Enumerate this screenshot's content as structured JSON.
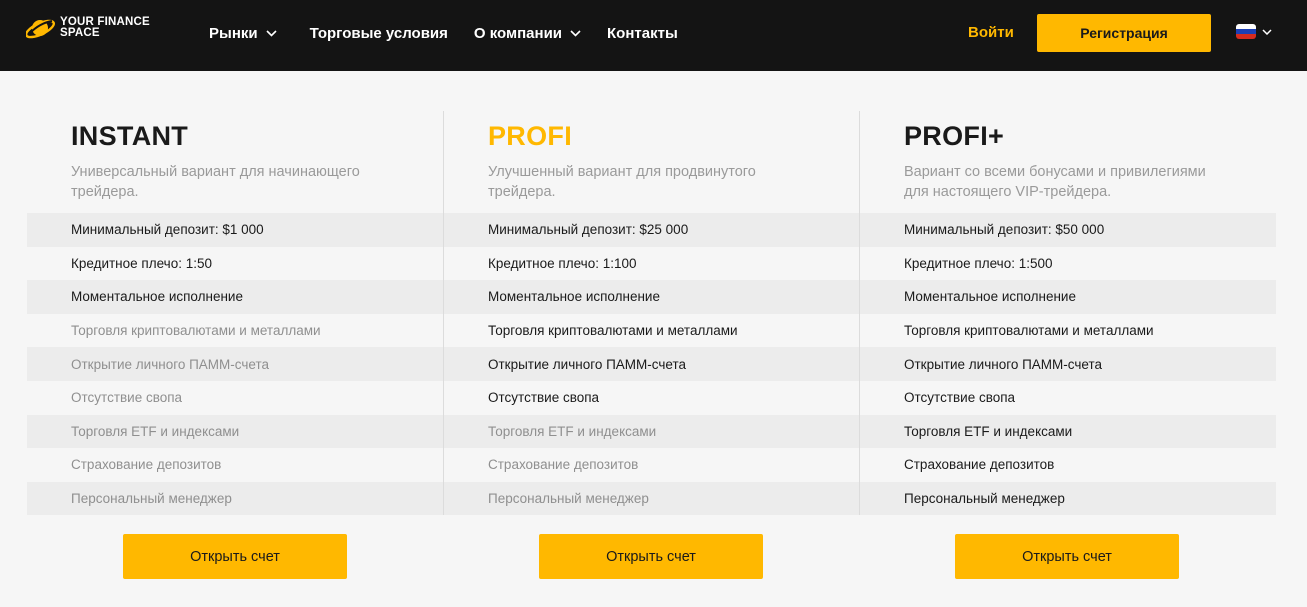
{
  "header": {
    "logo_text": "YOUR FINANCE\nSPACE",
    "nav": [
      {
        "label": "Рынки",
        "has_dropdown": true
      },
      {
        "label": "Торговые условия",
        "has_dropdown": false
      },
      {
        "label": "О компании",
        "has_dropdown": true
      },
      {
        "label": "Контакты",
        "has_dropdown": false
      }
    ],
    "login_label": "Войти",
    "register_label": "Регистрация",
    "language": "flag-ru-icon"
  },
  "colors": {
    "accent": "#ffb800",
    "header_bg": "#141414",
    "page_bg": "#f6f6f6"
  },
  "plans": [
    {
      "title": "INSTANT",
      "title_color": "#1a1a1a",
      "description": "Универсальный вариант для начинающего трейдера.",
      "features": [
        {
          "label": "Минимальный депозит: $1 000",
          "included": true
        },
        {
          "label": "Кредитное плечо: 1:50",
          "included": true
        },
        {
          "label": "Моментальное исполнение",
          "included": true
        },
        {
          "label": "Торговля криптовалютами и металлами",
          "included": false
        },
        {
          "label": "Открытие личного ПАММ-счета",
          "included": false
        },
        {
          "label": "Отсутствие свопа",
          "included": false
        },
        {
          "label": "Торговля ETF и индексами",
          "included": false
        },
        {
          "label": "Страхование депозитов",
          "included": false
        },
        {
          "label": "Персональный менеджер",
          "included": false
        }
      ],
      "button_label": "Открыть счет"
    },
    {
      "title": "PROFI",
      "title_color": "#ffb800",
      "description": "Улучшенный вариант для продвинутого трейдера.",
      "features": [
        {
          "label": "Минимальный депозит: $25 000",
          "included": true
        },
        {
          "label": "Кредитное плечо: 1:100",
          "included": true
        },
        {
          "label": "Моментальное исполнение",
          "included": true
        },
        {
          "label": "Торговля криптовалютами и металлами",
          "included": true
        },
        {
          "label": "Открытие личного ПАММ-счета",
          "included": true
        },
        {
          "label": "Отсутствие свопа",
          "included": true
        },
        {
          "label": "Торговля ETF и индексами",
          "included": false
        },
        {
          "label": "Страхование депозитов",
          "included": false
        },
        {
          "label": "Персональный менеджер",
          "included": false
        }
      ],
      "button_label": "Открыть счет"
    },
    {
      "title": "PROFI+",
      "title_color": "#1a1a1a",
      "description": "Вариант со всеми бонусами и привилегиями для настоящего VIP-трейдера.",
      "features": [
        {
          "label": "Минимальный депозит: $50 000",
          "included": true
        },
        {
          "label": "Кредитное плечо: 1:500",
          "included": true
        },
        {
          "label": "Моментальное исполнение",
          "included": true
        },
        {
          "label": "Торговля криптовалютами и металлами",
          "included": true
        },
        {
          "label": "Открытие личного ПАММ-счета",
          "included": true
        },
        {
          "label": "Отсутствие свопа",
          "included": true
        },
        {
          "label": "Торговля ETF и индексами",
          "included": true
        },
        {
          "label": "Страхование депозитов",
          "included": true
        },
        {
          "label": "Персональный менеджер",
          "included": true
        }
      ],
      "button_label": "Открыть счет"
    }
  ]
}
